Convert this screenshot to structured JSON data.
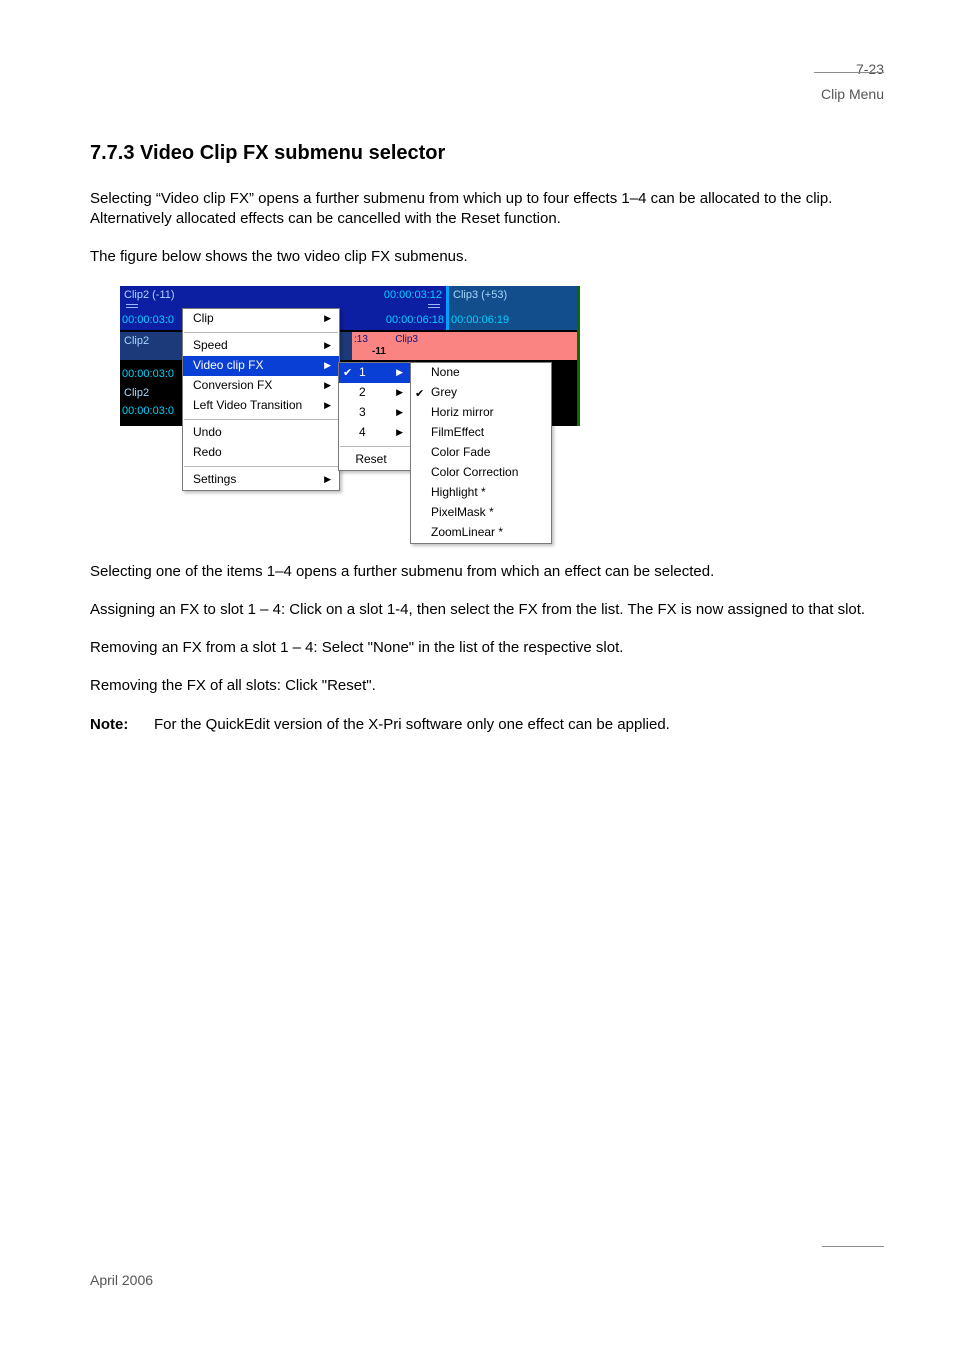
{
  "page": {
    "number": "7-23",
    "header": "Clip Menu",
    "footer": "April 2006"
  },
  "section_title": "7.7.3 Video Clip FX submenu selector",
  "para1": "Selecting “Video clip FX” opens a further submenu from which up to four effects 1–4 can be allocated to the clip. Alternatively allocated effects can be cancelled with the Reset function.",
  "para2": "The figure below shows the two video clip FX submenus.",
  "figure": {
    "timeline": {
      "clip2_name": "Clip2 (-11)",
      "clip2_tc_left": "00:00:03:0",
      "clip2_tc_right_top": "00:00:03:12",
      "clip2_tc_right_bottom": "00:00:06:18",
      "clip3_name": "Clip3 (+53)",
      "clip3_tc": "00:00:06:19",
      "row2_clip2": "Clip2",
      "row2_t1": ":13",
      "row2_t2": "Clip3",
      "row2_t3": "-11",
      "row3_tc": "00:00:03:0",
      "row4_name": "Clip2",
      "row5_tc": "00:00:03:0"
    },
    "menu1": {
      "clip": "Clip",
      "speed": "Speed",
      "video_clip_fx": "Video clip FX",
      "conversion_fx": "Conversion FX",
      "left_video_transition": "Left Video Transition",
      "undo": "Undo",
      "redo": "Redo",
      "settings": "Settings"
    },
    "menu2": {
      "i1": "1",
      "i2": "2",
      "i3": "3",
      "i4": "4",
      "reset": "Reset"
    },
    "menu3": {
      "none": "None",
      "grey": "Grey",
      "horiz": "Horiz mirror",
      "film": "FilmEffect",
      "colorfade": "Color Fade",
      "colorcorr": "Color Correction",
      "highlight": "Highlight *",
      "pixelmask": "PixelMask *",
      "zoom": "ZoomLinear *"
    }
  },
  "para3": "Selecting one of the items 1–4 opens a further submenu from which an effect can be selected.",
  "para4": "Assigning an FX to slot 1 – 4: Click on a slot 1-4, then select the FX from the list. The FX is now assigned to that slot.",
  "para5": "Removing an FX from a slot 1 – 4: Select \"None\" in the list of the respective slot.",
  "para6": "Removing the FX of all slots: Click \"Reset\".",
  "note_label": "Note:",
  "note_body": "For the QuickEdit version of the X-Pri software only one effect can be applied."
}
